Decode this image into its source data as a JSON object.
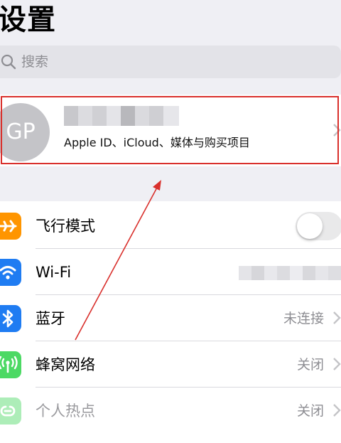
{
  "header": {
    "title": "设置"
  },
  "search": {
    "placeholder": "搜索"
  },
  "profile": {
    "avatar_initials": "GP",
    "subtitle": "Apple ID、iCloud、媒体与购买项目"
  },
  "settings": [
    {
      "label": "飞行模式",
      "icon": "airplane-icon",
      "color": "#ff9500",
      "control": "toggle",
      "toggle_on": false
    },
    {
      "label": "Wi-Fi",
      "icon": "wifi-icon",
      "color": "#1f7cf2",
      "control": "blurred-value"
    },
    {
      "label": "蓝牙",
      "icon": "bluetooth-icon",
      "color": "#1f7cf2",
      "value": "未连接"
    },
    {
      "label": "蜂窝网络",
      "icon": "cellular-antenna-icon",
      "color": "#4cd964",
      "value": "关闭"
    },
    {
      "label": "个人热点",
      "icon": "hotspot-icon",
      "color": "#4cd964",
      "value": "关闭",
      "disabled": true
    }
  ],
  "annotation": {
    "highlight_color": "#d9302c"
  }
}
